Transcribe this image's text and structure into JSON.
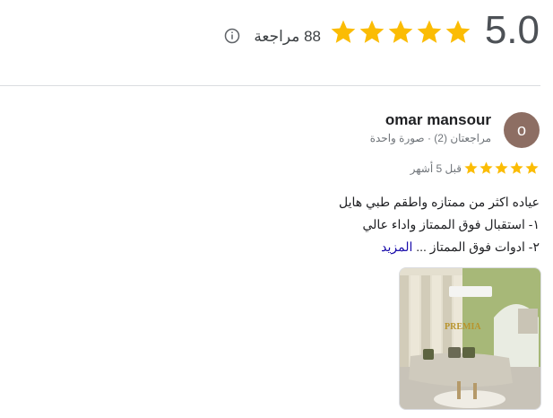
{
  "summary": {
    "rating": "5.0",
    "stars_filled": 5,
    "stars_total": 5,
    "review_count_label": "88 مراجعة"
  },
  "review": {
    "avatar_initial": "o",
    "reviewer_name": "omar mansour",
    "reviewer_meta": "مراجعتان (2) · صورة واحدة",
    "stars_filled": 5,
    "time_ago": "قبل 5 أشهر",
    "text_lines": [
      "عياده اكثر من ممتازه واطقم طبي هايل",
      "١- استقبال فوق الممتاز واداء عالي",
      "٢- ادوات فوق الممتاز ..."
    ],
    "more_label": "المزيد",
    "photo_sign": "PREMIA"
  },
  "colors": {
    "star": "#fbbc04",
    "avatar_bg": "#8d6e63",
    "link": "#1a0dab"
  }
}
